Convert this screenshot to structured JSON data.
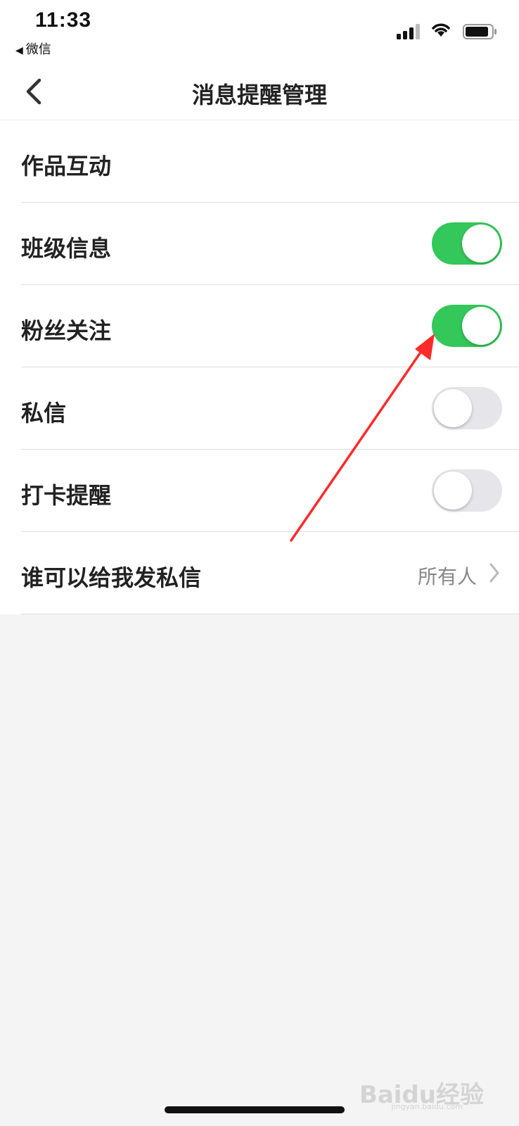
{
  "status_bar": {
    "time": "11:33",
    "back_app_label": "微信",
    "icons": [
      "signal-icon",
      "wifi-icon",
      "battery-icon"
    ]
  },
  "nav": {
    "title": "消息提醒管理",
    "back_icon": "chevron-left-icon"
  },
  "settings": [
    {
      "label": "作品互动",
      "type": "none"
    },
    {
      "label": "班级信息",
      "type": "toggle",
      "on": true
    },
    {
      "label": "粉丝关注",
      "type": "toggle",
      "on": true
    },
    {
      "label": "私信",
      "type": "toggle",
      "on": false
    },
    {
      "label": "打卡提醒",
      "type": "toggle",
      "on": false
    },
    {
      "label": "谁可以给我发私信",
      "type": "link",
      "value": "所有人"
    }
  ],
  "colors": {
    "toggle_on": "#34c759",
    "toggle_off": "#e5e5ea",
    "annotation_arrow": "#ff2a2a"
  },
  "watermark": {
    "text": "Baidu经验",
    "sub": "jingyan.baidu.com"
  }
}
